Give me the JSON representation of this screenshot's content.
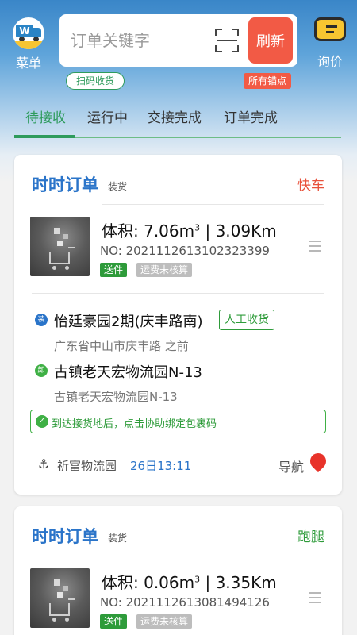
{
  "header": {
    "menu_label": "菜单",
    "menu_logo_letter": "W",
    "search_placeholder": "订单关键字",
    "refresh_label": "刷新",
    "inquiry_label": "询价",
    "scan_receive_label": "扫码收货",
    "all_anchors_label": "所有锚点"
  },
  "tabs": [
    {
      "label": "待接收",
      "active": true
    },
    {
      "label": "运行中"
    },
    {
      "label": "交接完成"
    },
    {
      "label": "订单完成"
    }
  ],
  "orders": [
    {
      "title": "时时订单",
      "load_tag": "装货",
      "type": "快车",
      "type_color": "#e8523c",
      "volume": "体积: 7.06m",
      "distance": "| 3.09Km",
      "order_no": "NO: 20211126131023233​99",
      "badge_send": "送件",
      "badge_fee": "运费未核算",
      "load_pin": "装",
      "load_name": "怡廷豪园2期(庆丰路南)",
      "manual_tag": "人工收货",
      "load_detail": "广东省中山市庆丰路 之前",
      "unload_pin": "卸",
      "unload_name": "古镇老天宏物流园N-13",
      "unload_detail": "古镇老天宏物流园N-13",
      "bind_tip": "到达接货地后，点击协助绑定包裹码",
      "park": "祈富物流园",
      "time": "26日13:11",
      "nav_label": "导航"
    },
    {
      "title": "时时订单",
      "load_tag": "装货",
      "type": "跑腿",
      "type_color": "#2e9b3a",
      "volume": "体积: 0.06m",
      "distance": "| 3.35Km",
      "order_no": "NO: 20211126130814941​26",
      "badge_send": "送件",
      "badge_fee": "运费未核算"
    }
  ]
}
